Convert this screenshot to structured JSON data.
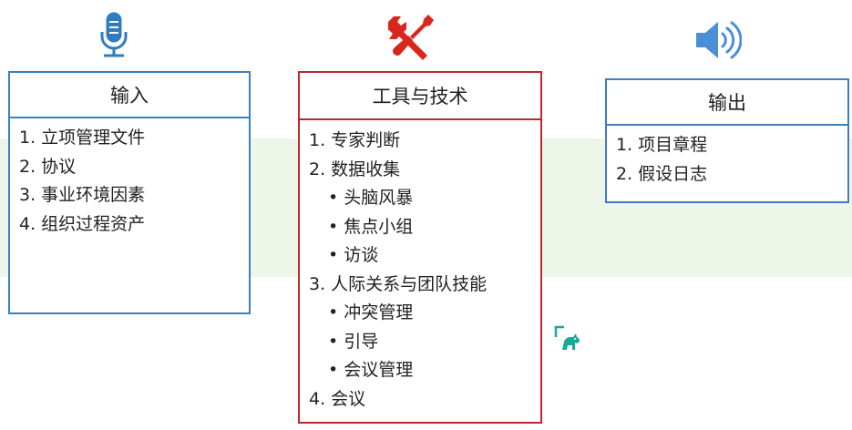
{
  "colors": {
    "input_border": "#3d7ebf",
    "tools_border": "#c0272d",
    "output_border": "#3d7ebf",
    "band": "#eef5e9",
    "microphone_icon": "#2f7dc0",
    "tools_icon": "#d9251c",
    "speaker_icon": "#4a8fd6",
    "watermark": "#17a89a"
  },
  "icons": {
    "input": "microphone-icon",
    "tools": "screwdriver-wrench-icon",
    "output": "speaker-icon",
    "watermark": "logo-icon"
  },
  "input": {
    "title": "输入",
    "items": [
      "1. 立项管理文件",
      "2. 协议",
      "3. 事业环境因素",
      "4. 组织过程资产"
    ]
  },
  "tools": {
    "title": "工具与技术",
    "items": [
      {
        "label": "1. 专家判断"
      },
      {
        "label": "2. 数据收集",
        "children": [
          "头脑风暴",
          "焦点小组",
          "访谈"
        ]
      },
      {
        "label": "3. 人际关系与团队技能",
        "children": [
          "冲突管理",
          "引导",
          "会议管理"
        ]
      },
      {
        "label": "4. 会议"
      }
    ]
  },
  "output": {
    "title": "输出",
    "items": [
      "1. 项目章程",
      "2. 假设日志"
    ]
  }
}
